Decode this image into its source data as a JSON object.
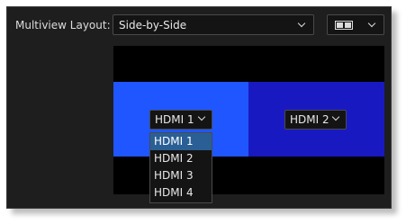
{
  "layout": {
    "label": "Multiview Layout:",
    "value": "Side-by-Side",
    "icon": "side-by-side-layout-icon"
  },
  "preview": {
    "left": {
      "source": "HDMI 1",
      "color": "#1f56ff"
    },
    "right": {
      "source": "HDMI 2",
      "color": "#1919c2"
    }
  },
  "dropdown": {
    "options": [
      "HDMI 1",
      "HDMI 2",
      "HDMI 3",
      "HDMI 4"
    ],
    "selected": "HDMI 1"
  }
}
